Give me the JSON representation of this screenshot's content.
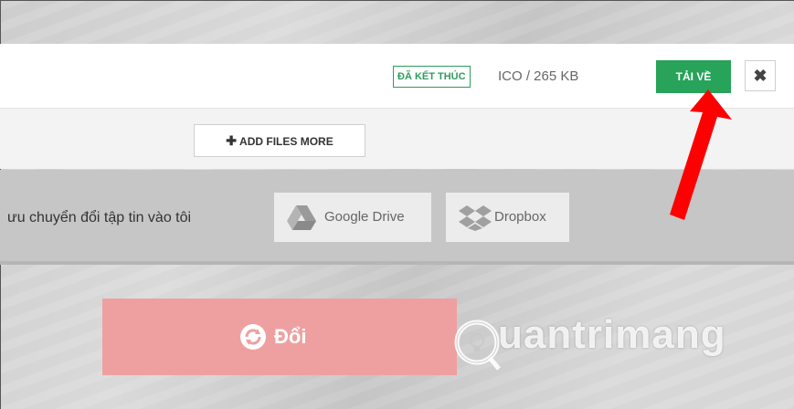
{
  "header": {
    "status_badge": "ĐÃ KẾT THÚC",
    "file_info": "ICO / 265 KB",
    "download_label": "TẢI VỀ",
    "close_symbol": "✖"
  },
  "toolbar": {
    "add_files_label": "ADD FILES MORE",
    "add_symbol": "✚"
  },
  "save": {
    "text": "ưu chuyển đổi tập tin vào tôi",
    "google_drive_label": "Google Drive",
    "dropbox_label": "Dropbox"
  },
  "convert": {
    "label": "Đổi"
  },
  "watermark": {
    "text": "uantrimang"
  },
  "colors": {
    "accent_green": "#27a35a",
    "convert_red": "#eea0a0",
    "arrow_red": "#ff0000"
  }
}
